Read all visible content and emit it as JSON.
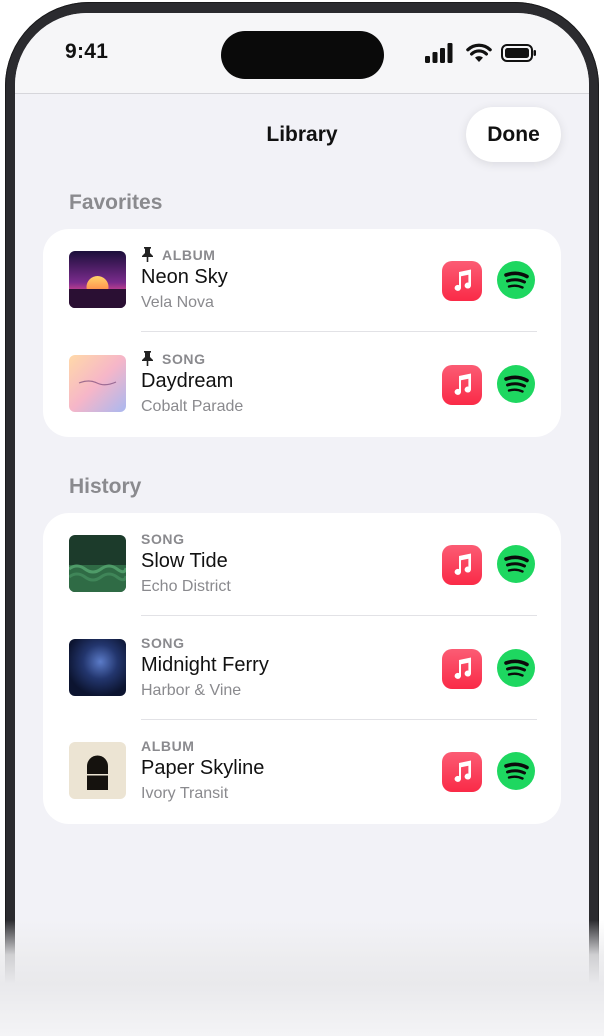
{
  "status_bar": {
    "time": "9:41"
  },
  "nav": {
    "title": "Library",
    "done_label": "Done"
  },
  "favorites": {
    "title": "Favorites",
    "items": [
      {
        "type": "ALBUM",
        "pinned": true,
        "title": "Neon Sky",
        "artist": "Vela Nova",
        "artwork_icon": "neon-sky-artwork"
      },
      {
        "type": "SONG",
        "pinned": true,
        "title": "Daydream",
        "artist": "Cobalt Parade",
        "artwork_icon": "daydream-artwork"
      }
    ]
  },
  "history": {
    "title": "History",
    "items": [
      {
        "type": "SONG",
        "pinned": false,
        "title": "Slow Tide",
        "artist": "Echo District",
        "artwork_icon": "slow-tide-artwork"
      },
      {
        "type": "SONG",
        "pinned": false,
        "title": "Midnight Ferry",
        "artist": "Harbor & Vine",
        "artwork_icon": "midnight-ferry-artwork"
      },
      {
        "type": "ALBUM",
        "pinned": false,
        "title": "Paper Skyline",
        "artist": "Ivory Transit",
        "artwork_icon": "paper-skyline-artwork"
      }
    ]
  },
  "service_icons": {
    "apple_music": "apple-music-icon",
    "spotify": "spotify-icon"
  },
  "colors": {
    "background": "#f2f2f7",
    "card": "#ffffff",
    "apple_music": "#fa2a47",
    "spotify": "#1ed760",
    "secondary_text": "#8a8a8e"
  }
}
